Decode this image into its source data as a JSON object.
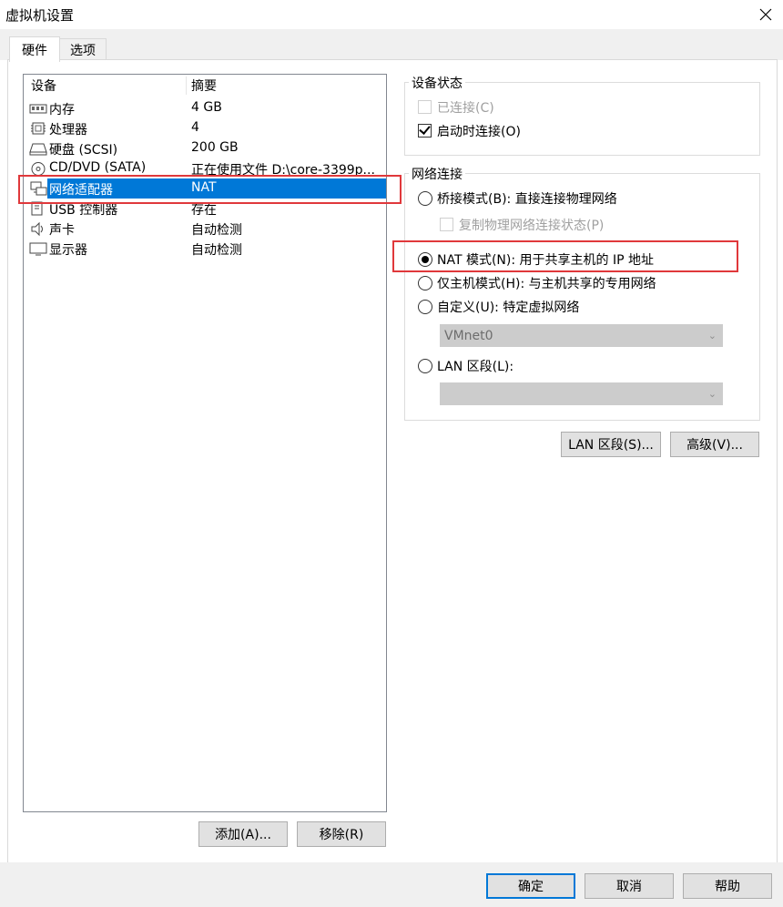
{
  "window": {
    "title": "虚拟机设置"
  },
  "tabs": [
    {
      "label": "硬件",
      "active": true
    },
    {
      "label": "选项",
      "active": false
    }
  ],
  "device_list": {
    "headers": {
      "device": "设备",
      "summary": "摘要"
    },
    "rows": [
      {
        "name": "内存",
        "summary": "4 GB",
        "icon": "memory-icon"
      },
      {
        "name": "处理器",
        "summary": "4",
        "icon": "cpu-icon"
      },
      {
        "name": "硬盘 (SCSI)",
        "summary": "200 GB",
        "icon": "hard-disk-icon"
      },
      {
        "name": "CD/DVD (SATA)",
        "summary": "正在使用文件 D:\\core-3399p...",
        "icon": "cd-dvd-icon"
      },
      {
        "name": "网络适配器",
        "summary": "NAT",
        "icon": "network-adapter-icon",
        "selected": true
      },
      {
        "name": "USB 控制器",
        "summary": "存在",
        "icon": "usb-icon"
      },
      {
        "name": "声卡",
        "summary": "自动检测",
        "icon": "speaker-icon"
      },
      {
        "name": "显示器",
        "summary": "自动检测",
        "icon": "monitor-icon"
      }
    ]
  },
  "device_buttons": {
    "add": "添加(A)...",
    "remove": "移除(R)"
  },
  "device_status": {
    "title": "设备状态",
    "connected": {
      "label": "已连接(C)",
      "checked": false,
      "enabled": false
    },
    "connect_at_power_on": {
      "label": "启动时连接(O)",
      "checked": true,
      "enabled": true
    }
  },
  "network": {
    "title": "网络连接",
    "bridged": {
      "label": "桥接模式(B): 直接连接物理网络",
      "selected": false
    },
    "replicate": {
      "label": "复制物理网络连接状态(P)",
      "checked": false,
      "enabled": false
    },
    "nat": {
      "label": "NAT 模式(N): 用于共享主机的 IP 地址",
      "selected": true
    },
    "host_only": {
      "label": "仅主机模式(H): 与主机共享的专用网络",
      "selected": false
    },
    "custom": {
      "label": "自定义(U): 特定虚拟网络",
      "selected": false,
      "select_value": "VMnet0"
    },
    "lan_segment": {
      "label": "LAN 区段(L):",
      "selected": false,
      "select_value": ""
    }
  },
  "network_buttons": {
    "lan_segments": "LAN 区段(S)...",
    "advanced": "高级(V)..."
  },
  "footer": {
    "ok": "确定",
    "cancel": "取消",
    "help": "帮助"
  },
  "colors": {
    "selection": "#0078d7",
    "highlight_box": "#e0383b"
  }
}
